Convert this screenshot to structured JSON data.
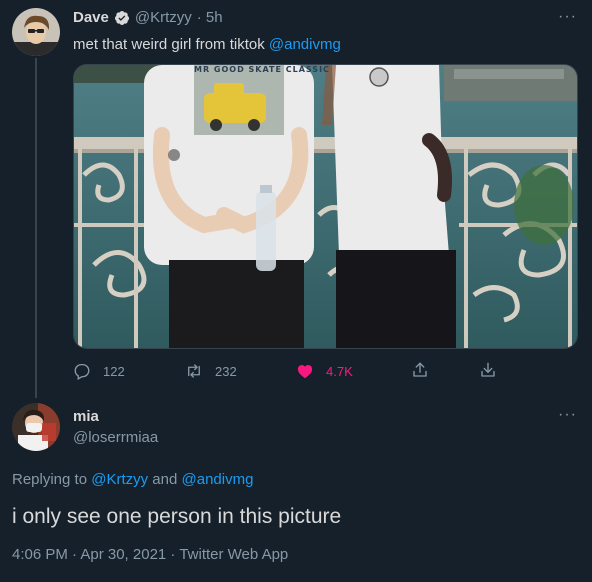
{
  "tweet": {
    "display_name": "Dave",
    "verified_icon": "verified-badge-icon",
    "handle": "@Krtzyy",
    "time": "· 5h",
    "text_prefix": "met that weird girl from tiktok ",
    "mention": "@andivmg",
    "more": "···",
    "stats": {
      "replies": "122",
      "retweets": "232",
      "likes": "4.7K"
    },
    "icons": {
      "reply": "reply-icon",
      "retweet": "retweet-icon",
      "like": "heart-icon",
      "share": "share-icon",
      "download": "download-icon"
    },
    "photo_shirt_text": "MR GOOD SKATE CLASSIC"
  },
  "reply": {
    "display_name": "mia",
    "handle": "@loserrmiaa",
    "more": "···",
    "replying_prefix": "Replying to ",
    "replying_user1": "@Krtzyy",
    "replying_and": " and ",
    "replying_user2": "@andivmg",
    "text": "i only see one person in this picture",
    "meta": "4:06 PM · Apr 30, 2021 · Twitter Web App"
  },
  "colors": {
    "background": "#15202b",
    "accent": "#1d9bf0",
    "like": "#f91880",
    "muted": "#8899a6"
  }
}
